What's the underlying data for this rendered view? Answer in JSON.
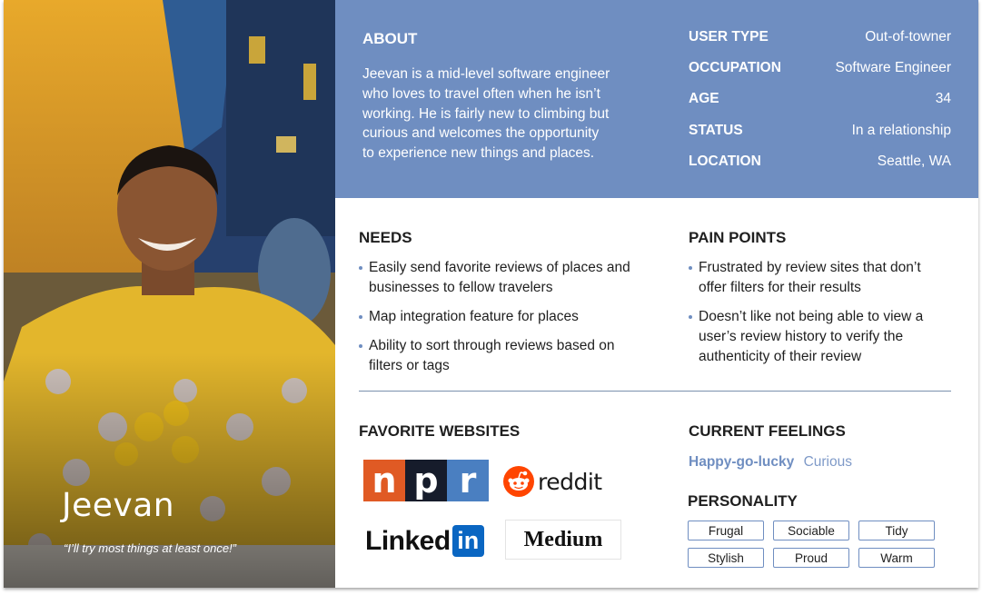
{
  "persona": {
    "name": "Jeevan",
    "quote": "“I’ll try most things at least once!”"
  },
  "about": {
    "title": "ABOUT",
    "text": "Jeevan is a mid-level software engineer who loves to travel often when he isn’t working. He is fairly new to climbing but curious and welcomes the opportunity to experience new things and places."
  },
  "facts": [
    {
      "label": "USER TYPE",
      "value": "Out-of-towner"
    },
    {
      "label": "OCCUPATION",
      "value": "Software Engineer"
    },
    {
      "label": "AGE",
      "value": "34"
    },
    {
      "label": "STATUS",
      "value": "In a relationship"
    },
    {
      "label": "LOCATION",
      "value": "Seattle, WA"
    }
  ],
  "needs": {
    "title": "NEEDS",
    "items": [
      "Easily send favorite reviews of places and businesses to fellow travelers",
      "Map integration feature for places",
      "Ability to sort through reviews based on filters or tags"
    ]
  },
  "pain_points": {
    "title": "PAIN POINTS",
    "items": [
      "Frustrated by review sites that don’t offer filters for their results",
      "Doesn’t like not being able to view a user’s review history to verify the authenticity of their review"
    ]
  },
  "websites": {
    "title": "FAVORITE WEBSITES",
    "npr": [
      "n",
      "p",
      "r"
    ],
    "reddit": "reddit",
    "linkedin": {
      "word": "Linked",
      "box": "in"
    },
    "medium": "Medium"
  },
  "feelings": {
    "title": "CURRENT FEELINGS",
    "primary": "Happy-go-lucky",
    "secondary": "Curious"
  },
  "personality": {
    "title": "PERSONALITY",
    "tags": [
      "Frugal",
      "Sociable",
      "Tidy",
      "Stylish",
      "Proud",
      "Warm"
    ]
  },
  "colors": {
    "accent": "#6f8ec1",
    "npr_n": "#e05a24",
    "npr_p": "#161c2b",
    "npr_r": "#4a7fc1",
    "reddit": "#ff4500",
    "linkedin": "#0a66c2"
  }
}
